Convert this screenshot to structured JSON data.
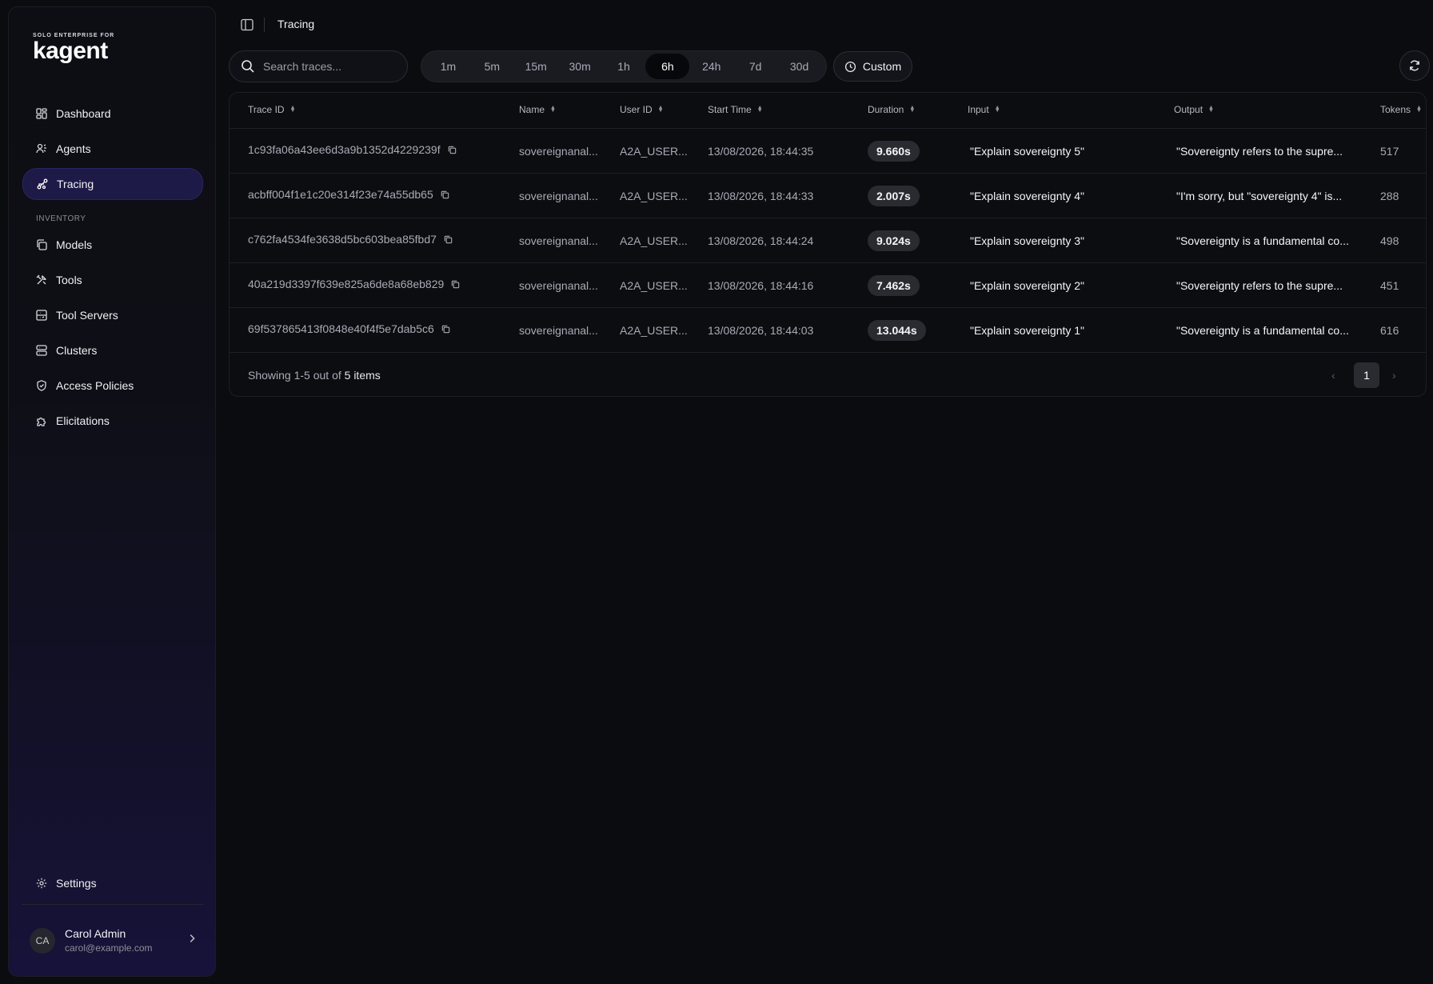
{
  "brand": {
    "small": "SOLO ENTERPRISE FOR",
    "name": "kagent"
  },
  "nav": {
    "dashboard": "Dashboard",
    "agents": "Agents",
    "tracing": "Tracing",
    "inventory_label": "INVENTORY",
    "models": "Models",
    "tools": "Tools",
    "tool_servers": "Tool Servers",
    "clusters": "Clusters",
    "access_policies": "Access Policies",
    "elicitations": "Elicitations",
    "settings": "Settings"
  },
  "user": {
    "initials": "CA",
    "name": "Carol Admin",
    "email": "carol@example.com"
  },
  "header": {
    "title": "Tracing"
  },
  "search": {
    "placeholder": "Search traces..."
  },
  "ranges": [
    "1m",
    "5m",
    "15m",
    "30m",
    "1h",
    "6h",
    "24h",
    "7d",
    "30d"
  ],
  "selected_range": "6h",
  "custom_label": "Custom",
  "table": {
    "columns": {
      "trace_id": "Trace ID",
      "name": "Name",
      "user_id": "User ID",
      "start_time": "Start Time",
      "duration": "Duration",
      "input": "Input",
      "output": "Output",
      "tokens": "Tokens"
    },
    "rows": [
      {
        "trace_id": "1c93fa06a43ee6d3a9b1352d4229239f",
        "name": "sovereignanal...",
        "user_id": "A2A_USER...",
        "start_time": "13/08/2026, 18:44:35",
        "duration": "9.660s",
        "input": "\"Explain sovereignty 5\"",
        "output": "\"Sovereignty refers to the supre...",
        "tokens": "517"
      },
      {
        "trace_id": "acbff004f1e1c20e314f23e74a55db65",
        "name": "sovereignanal...",
        "user_id": "A2A_USER...",
        "start_time": "13/08/2026, 18:44:33",
        "duration": "2.007s",
        "input": "\"Explain sovereignty 4\"",
        "output": "\"I'm sorry, but \"sovereignty 4\" is...",
        "tokens": "288"
      },
      {
        "trace_id": "c762fa4534fe3638d5bc603bea85fbd7",
        "name": "sovereignanal...",
        "user_id": "A2A_USER...",
        "start_time": "13/08/2026, 18:44:24",
        "duration": "9.024s",
        "input": "\"Explain sovereignty 3\"",
        "output": "\"Sovereignty is a fundamental co...",
        "tokens": "498"
      },
      {
        "trace_id": "40a219d3397f639e825a6de8a68eb829",
        "name": "sovereignanal...",
        "user_id": "A2A_USER...",
        "start_time": "13/08/2026, 18:44:16",
        "duration": "7.462s",
        "input": "\"Explain sovereignty 2\"",
        "output": "\"Sovereignty refers to the supre...",
        "tokens": "451"
      },
      {
        "trace_id": "69f537865413f0848e40f4f5e7dab5c6",
        "name": "sovereignanal...",
        "user_id": "A2A_USER...",
        "start_time": "13/08/2026, 18:44:03",
        "duration": "13.044s",
        "input": "\"Explain sovereignty 1\"",
        "output": "\"Sovereignty is a fundamental co...",
        "tokens": "616"
      }
    ]
  },
  "footer": {
    "showing_prefix": "Showing 1-5 out of ",
    "showing_count": "5 items",
    "page": "1",
    "prev": "‹",
    "next": "›"
  }
}
